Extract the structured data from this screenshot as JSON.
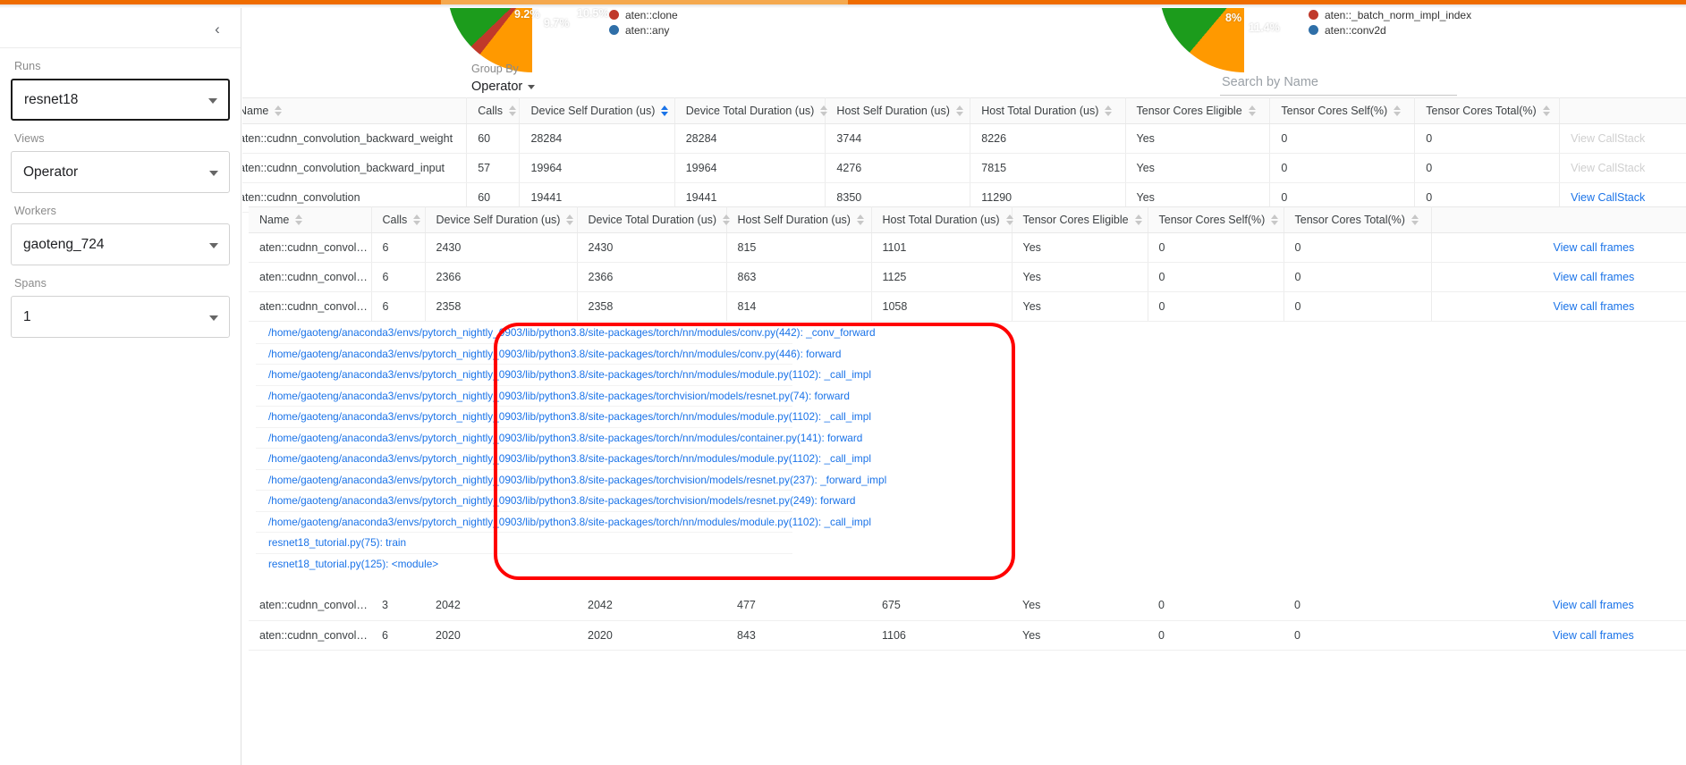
{
  "app": {
    "accent_color": "#ef6c00",
    "link_color": "#1a73e8",
    "highlight_color": "#ff0000"
  },
  "sidebar": {
    "collapse_icon": "‹",
    "groups": [
      {
        "label": "Runs",
        "value": "resnet18",
        "focused": true,
        "name": "runs"
      },
      {
        "label": "Views",
        "value": "Operator",
        "focused": false,
        "name": "views"
      },
      {
        "label": "Workers",
        "value": "gaoteng_724",
        "focused": false,
        "name": "workers"
      },
      {
        "label": "Spans",
        "value": "1",
        "focused": false,
        "name": "spans"
      }
    ]
  },
  "charts": [
    {
      "name": "device-self-time-pie",
      "slices": [
        {
          "label": "9.2%",
          "color": "#aa00aa"
        },
        {
          "label": "9.7%",
          "color": "#1c9c1c"
        },
        {
          "label": "10.5%",
          "color": "#ff9900"
        }
      ],
      "legend": [
        {
          "label": "aten::clone",
          "color": "#c0392b"
        },
        {
          "label": "aten::any",
          "color": "#2f6fa8"
        }
      ]
    },
    {
      "name": "host-self-time-pie",
      "slices": [
        {
          "label": "8%",
          "color": "#aa00aa"
        },
        {
          "label": "11.4%",
          "color": "#1c9c1c"
        },
        {
          "label": "",
          "color": "#ff9900"
        }
      ],
      "legend": [
        {
          "label": "aten::_batch_norm_impl_index",
          "color": "#c0392b"
        },
        {
          "label": "aten::conv2d",
          "color": "#2f6fa8"
        }
      ]
    }
  ],
  "controls": {
    "group_by_label": "Group By",
    "group_by_value": "Operator",
    "search_placeholder": "Search by Name",
    "search_value": ""
  },
  "table": {
    "columns": [
      {
        "label": "Name",
        "sorted": false
      },
      {
        "label": "Calls",
        "sorted": false
      },
      {
        "label": "Device Self Duration (us)",
        "sorted": true
      },
      {
        "label": "Device Total Duration (us)",
        "sorted": false
      },
      {
        "label": "Host Self Duration (us)",
        "sorted": false
      },
      {
        "label": "Host Total Duration (us)",
        "sorted": false
      },
      {
        "label": "Tensor Cores Eligible",
        "sorted": false
      },
      {
        "label": "Tensor Cores Self(%)",
        "sorted": false
      },
      {
        "label": "Tensor Cores Total(%)",
        "sorted": false
      },
      {
        "label": "",
        "sorted": false
      }
    ],
    "rows": [
      {
        "name": "aten::cudnn_convolution_backward_weight",
        "calls": "60",
        "device_self": "28284",
        "device_total": "28284",
        "host_self": "3744",
        "host_total": "8226",
        "tc_eligible": "Yes",
        "tc_self": "0",
        "tc_total": "0",
        "action": "View CallStack",
        "action_state": "disabled"
      },
      {
        "name": "aten::cudnn_convolution_backward_input",
        "calls": "57",
        "device_self": "19964",
        "device_total": "19964",
        "host_self": "4276",
        "host_total": "7815",
        "tc_eligible": "Yes",
        "tc_self": "0",
        "tc_total": "0",
        "action": "View CallStack",
        "action_state": "disabled"
      },
      {
        "name": "aten::cudnn_convolution",
        "calls": "60",
        "device_self": "19441",
        "device_total": "19441",
        "host_self": "8350",
        "host_total": "11290",
        "tc_eligible": "Yes",
        "tc_self": "0",
        "tc_total": "0",
        "action": "View CallStack",
        "action_state": "active"
      }
    ]
  },
  "nested_table": {
    "columns": [
      {
        "label": "Name"
      },
      {
        "label": "Calls"
      },
      {
        "label": "Device Self Duration (us)"
      },
      {
        "label": "Device Total Duration (us)"
      },
      {
        "label": "Host Self Duration (us)"
      },
      {
        "label": "Host Total Duration (us)"
      },
      {
        "label": "Tensor Cores Eligible"
      },
      {
        "label": "Tensor Cores Self(%)"
      },
      {
        "label": "Tensor Cores Total(%)"
      },
      {
        "label": ""
      }
    ],
    "rows": [
      {
        "name": "aten::cudnn_convolution",
        "calls": "6",
        "device_self": "2430",
        "device_total": "2430",
        "host_self": "815",
        "host_total": "1101",
        "tc_eligible": "Yes",
        "tc_self": "0",
        "tc_total": "0",
        "action": "View call frames"
      },
      {
        "name": "aten::cudnn_convolution",
        "calls": "6",
        "device_self": "2366",
        "device_total": "2366",
        "host_self": "863",
        "host_total": "1125",
        "tc_eligible": "Yes",
        "tc_self": "0",
        "tc_total": "0",
        "action": "View call frames"
      },
      {
        "name": "aten::cudnn_convolution",
        "calls": "6",
        "device_self": "2358",
        "device_total": "2358",
        "host_self": "814",
        "host_total": "1058",
        "tc_eligible": "Yes",
        "tc_self": "0",
        "tc_total": "0",
        "action": "View call frames"
      }
    ],
    "rows_after": [
      {
        "name": "aten::cudnn_convolution",
        "calls": "3",
        "device_self": "2042",
        "device_total": "2042",
        "host_self": "477",
        "host_total": "675",
        "tc_eligible": "Yes",
        "tc_self": "0",
        "tc_total": "0",
        "action": "View call frames"
      },
      {
        "name": "aten::cudnn_convolution",
        "calls": "6",
        "device_self": "2020",
        "device_total": "2020",
        "host_self": "843",
        "host_total": "1106",
        "tc_eligible": "Yes",
        "tc_self": "0",
        "tc_total": "0",
        "action": "View call frames"
      }
    ]
  },
  "callstack": {
    "frames": [
      "/home/gaoteng/anaconda3/envs/pytorch_nightly_0903/lib/python3.8/site-packages/torch/nn/modules/conv.py(442): _conv_forward",
      "/home/gaoteng/anaconda3/envs/pytorch_nightly_0903/lib/python3.8/site-packages/torch/nn/modules/conv.py(446): forward",
      "/home/gaoteng/anaconda3/envs/pytorch_nightly_0903/lib/python3.8/site-packages/torch/nn/modules/module.py(1102): _call_impl",
      "/home/gaoteng/anaconda3/envs/pytorch_nightly_0903/lib/python3.8/site-packages/torchvision/models/resnet.py(74): forward",
      "/home/gaoteng/anaconda3/envs/pytorch_nightly_0903/lib/python3.8/site-packages/torch/nn/modules/module.py(1102): _call_impl",
      "/home/gaoteng/anaconda3/envs/pytorch_nightly_0903/lib/python3.8/site-packages/torch/nn/modules/container.py(141): forward",
      "/home/gaoteng/anaconda3/envs/pytorch_nightly_0903/lib/python3.8/site-packages/torch/nn/modules/module.py(1102): _call_impl",
      "/home/gaoteng/anaconda3/envs/pytorch_nightly_0903/lib/python3.8/site-packages/torchvision/models/resnet.py(237): _forward_impl",
      "/home/gaoteng/anaconda3/envs/pytorch_nightly_0903/lib/python3.8/site-packages/torchvision/models/resnet.py(249): forward",
      "/home/gaoteng/anaconda3/envs/pytorch_nightly_0903/lib/python3.8/site-packages/torch/nn/modules/module.py(1102): _call_impl",
      "resnet18_tutorial.py(75): train",
      "resnet18_tutorial.py(125): <module>"
    ]
  }
}
